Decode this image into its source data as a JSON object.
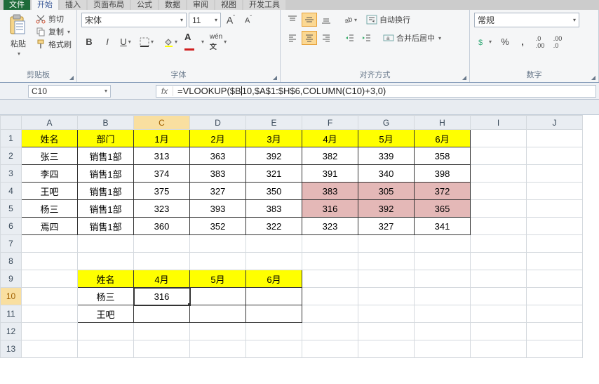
{
  "tabs": {
    "file": "文件",
    "home": "开始",
    "insert": "插入",
    "layout": "页面布局",
    "formulas": "公式",
    "data": "数据",
    "review": "审阅",
    "view": "视图",
    "dev": "开发工具"
  },
  "ribbon": {
    "clipboard": {
      "paste": "粘贴",
      "cut": "剪切",
      "copy": "复制",
      "fmtpainter": "格式刷",
      "label": "剪贴板"
    },
    "font": {
      "name": "宋体",
      "size": "11",
      "label": "字体"
    },
    "align": {
      "wrap": "自动换行",
      "merge": "合并后居中",
      "label": "对齐方式"
    },
    "number": {
      "format": "常规",
      "label": "数字"
    }
  },
  "namebox": "C10",
  "formula": "=VLOOKUP($B10,$A$1:$H$6,COLUMN(C10)+3,0)",
  "colHeaders": [
    "A",
    "B",
    "C",
    "D",
    "E",
    "F",
    "G",
    "H",
    "I",
    "J"
  ],
  "table1": {
    "headers": [
      "姓名",
      "部门",
      "1月",
      "2月",
      "3月",
      "4月",
      "5月",
      "6月"
    ],
    "rows": [
      {
        "name": "张三",
        "dept": "销售1部",
        "m": [
          313,
          363,
          392,
          382,
          339,
          358
        ]
      },
      {
        "name": "李四",
        "dept": "销售1部",
        "m": [
          374,
          383,
          321,
          391,
          340,
          398
        ]
      },
      {
        "name": "王吧",
        "dept": "销售1部",
        "m": [
          375,
          327,
          350,
          383,
          305,
          372
        ],
        "pink": [
          3,
          4,
          5
        ]
      },
      {
        "name": "杨三",
        "dept": "销售1部",
        "m": [
          323,
          393,
          383,
          316,
          392,
          365
        ],
        "pink": [
          3,
          4,
          5
        ]
      },
      {
        "name": "焉四",
        "dept": "销售1部",
        "m": [
          360,
          352,
          322,
          323,
          327,
          341
        ]
      }
    ]
  },
  "table2": {
    "headers": [
      "姓名",
      "4月",
      "5月",
      "6月"
    ],
    "rows": [
      {
        "name": "杨三",
        "v": [
          "316",
          "",
          ""
        ]
      },
      {
        "name": "王吧",
        "v": [
          "",
          "",
          ""
        ]
      }
    ]
  },
  "chart_data": {
    "type": "table",
    "title": "",
    "columns": [
      "姓名",
      "部门",
      "1月",
      "2月",
      "3月",
      "4月",
      "5月",
      "6月"
    ],
    "rows": [
      [
        "张三",
        "销售1部",
        313,
        363,
        392,
        382,
        339,
        358
      ],
      [
        "李四",
        "销售1部",
        374,
        383,
        321,
        391,
        340,
        398
      ],
      [
        "王吧",
        "销售1部",
        375,
        327,
        350,
        383,
        305,
        372
      ],
      [
        "杨三",
        "销售1部",
        323,
        393,
        383,
        316,
        392,
        365
      ],
      [
        "焉四",
        "销售1部",
        360,
        352,
        322,
        323,
        327,
        341
      ]
    ]
  }
}
